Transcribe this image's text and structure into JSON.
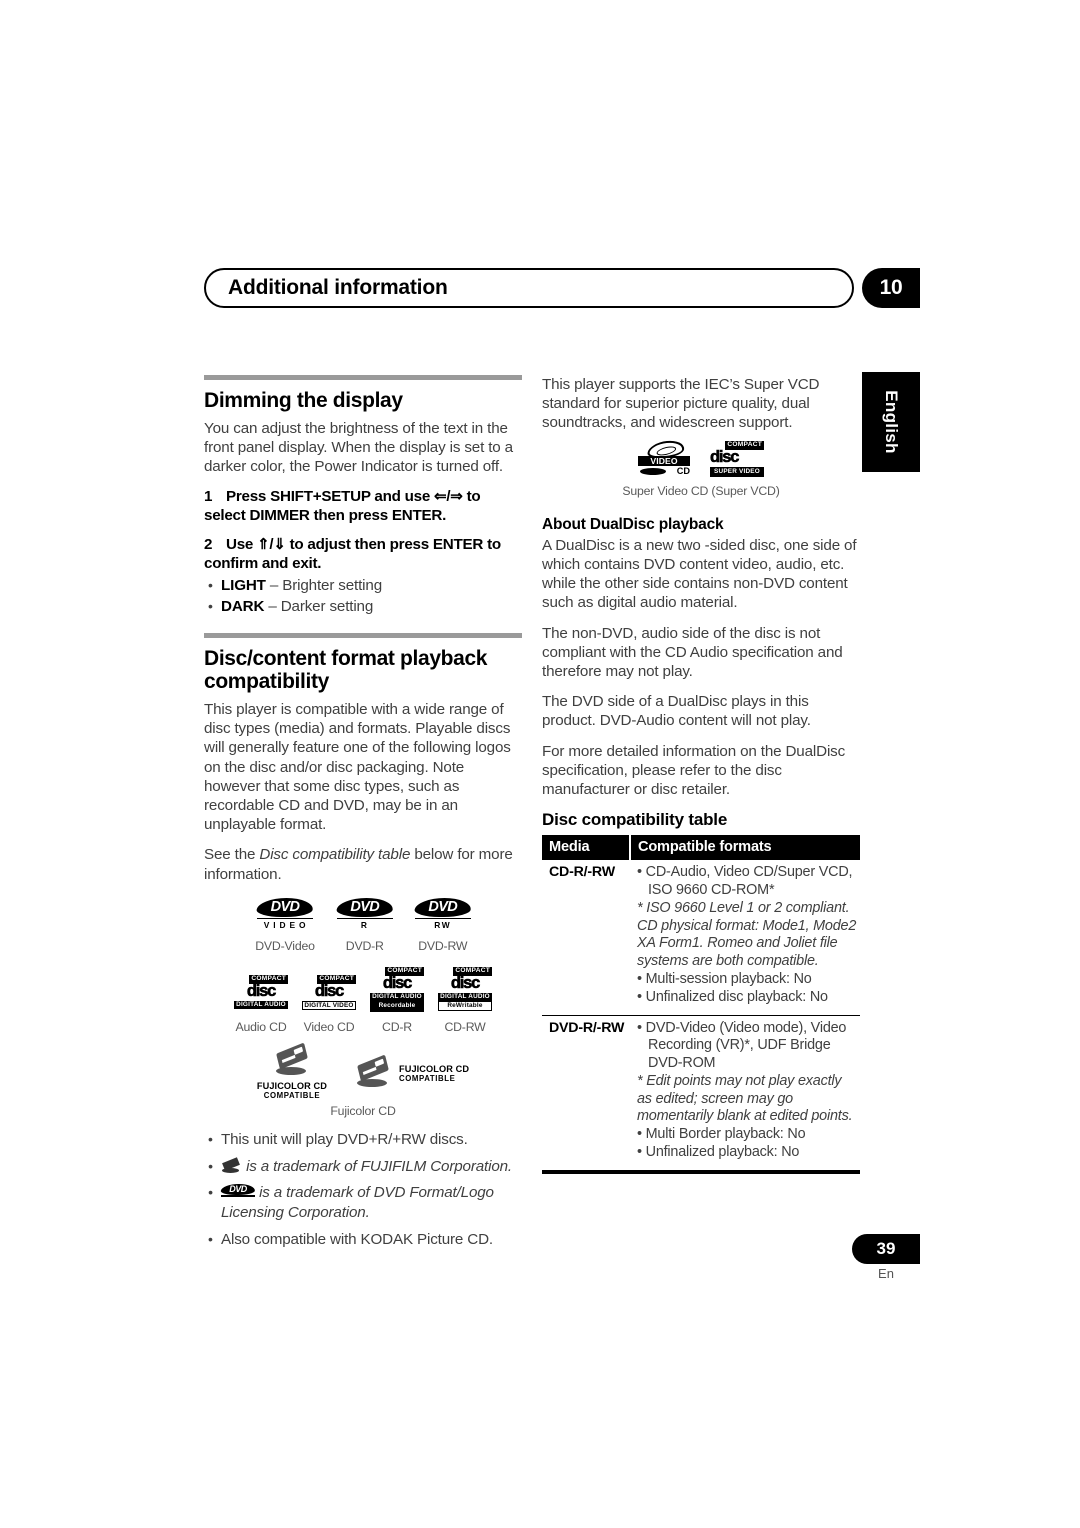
{
  "header": {
    "chapter_title": "Additional information",
    "chapter_number": "10",
    "language_tab": "English"
  },
  "footer": {
    "page_number": "39",
    "page_lang": "En"
  },
  "left_column": {
    "section1": {
      "heading": "Dimming the display",
      "intro": "You can adjust the brightness of the text in the front panel display. When the display is set to a darker color, the Power Indicator is turned off.",
      "step1_num": "1",
      "step1_text_a": "Press SHIFT+SETUP and use ",
      "step1_arrows": "⇐/⇒",
      "step1_text_b": " to select DIMMER then press ENTER.",
      "step2_num": "2",
      "step2_text_a": "Use ",
      "step2_arrows": "⇑/⇓",
      "step2_text_b": " to adjust then press ENTER to confirm and exit.",
      "options": [
        {
          "label": "LIGHT",
          "desc": " – Brighter setting"
        },
        {
          "label": "DARK",
          "desc": " – Darker setting"
        }
      ]
    },
    "section2": {
      "heading": "Disc/content format playback compatibility",
      "para1": "This player is compatible with a wide range of disc types (media) and formats. Playable discs will generally feature one of the following logos on the disc and/or disc packaging. Note however that some disc types, such as recordable CD and DVD, may be in an unplayable format.",
      "para2_a": "See the ",
      "para2_italic": "Disc compatibility table",
      "para2_b": " below for more information."
    },
    "logos": {
      "dvd_row": [
        {
          "word": "DVD",
          "sub": "V I D E O",
          "caption": "DVD-Video"
        },
        {
          "word": "DVD",
          "sub": "R",
          "caption": "DVD-R"
        },
        {
          "word": "DVD",
          "sub": "RW",
          "caption": "DVD-RW"
        }
      ],
      "cd_row": [
        {
          "compact": "COMPACT",
          "disc": "disc",
          "band": "DIGITAL AUDIO",
          "band_style": "solid",
          "caption": "Audio CD"
        },
        {
          "compact": "COMPACT",
          "disc": "disc",
          "band": "DIGITAL VIDEO",
          "band_style": "outline",
          "caption": "Video CD"
        },
        {
          "compact": "COMPACT",
          "disc": "disc",
          "band": "DIGITAL AUDIO",
          "band2": "Recordable",
          "band_style": "invert",
          "caption": "CD-R"
        },
        {
          "compact": "COMPACT",
          "disc": "disc",
          "band": "DIGITAL AUDIO",
          "band2": "ReWritable",
          "band_style": "outline",
          "caption": "CD-RW"
        }
      ],
      "fuji": {
        "stacked_line1": "FUJICOLOR CD",
        "stacked_line2": "COMPATIBLE",
        "inline_line1": "FUJICOLOR CD",
        "inline_line2": "COMPATIBLE",
        "caption": "Fujicolor CD"
      }
    },
    "notes": [
      {
        "text": "This unit will play DVD+R/+RW discs.",
        "icon": "none",
        "italic": false
      },
      {
        "text": " is a trademark of FUJIFILM Corporation.",
        "icon": "fuji",
        "italic": true
      },
      {
        "text": " is a trademark of DVD Format/Logo Licensing Corporation.",
        "icon": "dvd",
        "italic": true
      },
      {
        "text": "Also compatible with KODAK Picture CD.",
        "icon": "none",
        "italic": false
      }
    ]
  },
  "right_column": {
    "svcd_para": "This player supports the IEC’s Super VCD standard for superior picture quality, dual soundtracks, and widescreen support.",
    "svcd_logo": {
      "video": "VIDEO",
      "cd": "CD",
      "compact": "COMPACT",
      "disc": "disc",
      "band": "SUPER VIDEO",
      "caption": "Super Video CD (Super VCD)"
    },
    "dualdisc": {
      "heading": "About DualDisc playback",
      "para1": "A DualDisc is a new two -sided disc, one side of which contains DVD content video, audio, etc. while the other side contains non-DVD content such as digital audio material.",
      "para2": "The non-DVD, audio side of the disc is not compliant with the CD Audio specification and therefore may not play.",
      "para3": "The DVD side of a DualDisc plays in this product. DVD-Audio content will not play.",
      "para4": "For more detailed information on the DualDisc specification, please refer to the disc manufacturer or disc retailer."
    },
    "table": {
      "heading": "Disc compatibility table",
      "columns": [
        "Media",
        "Compatible formats"
      ],
      "rows": [
        {
          "media": "CD-R/-RW",
          "bullets": [
            "CD-Audio, Video CD/Super VCD, ISO 9660 CD-ROM*"
          ],
          "note": "* ISO 9660 Level 1 or 2 compliant. CD physical format: Mode1, Mode2 XA Form1. Romeo and Joliet file systems are both compatible.",
          "bullets_after": [
            "Multi-session playback: No",
            "Unfinalized disc playback: No"
          ]
        },
        {
          "media": "DVD-R/-RW",
          "bullets": [
            " DVD-Video (Video mode), Video Recording (VR)*, UDF Bridge DVD-ROM"
          ],
          "note": "* Edit points may not play exactly as edited; screen may go momentarily blank at edited points.",
          "bullets_after": [
            "Multi Border playback: No",
            "Unfinalized playback: No"
          ]
        }
      ]
    }
  }
}
